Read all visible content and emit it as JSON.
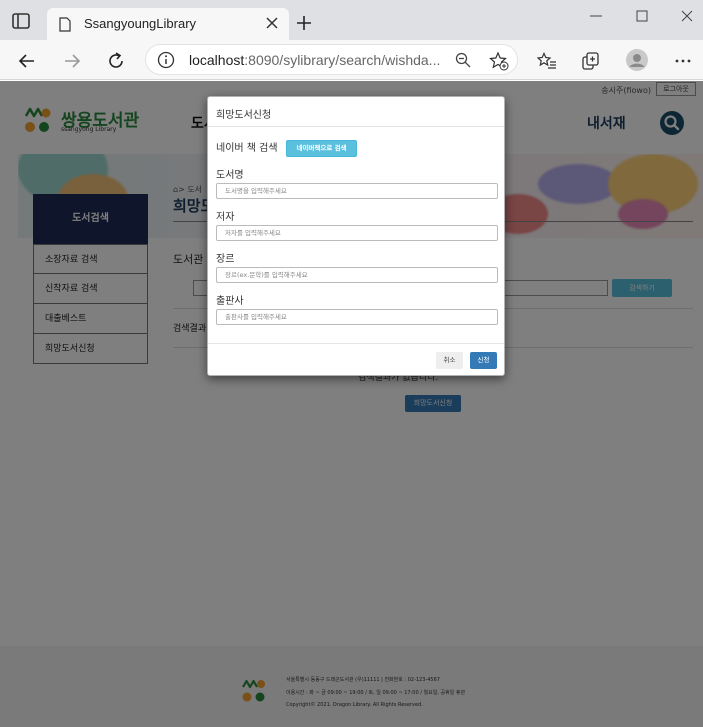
{
  "browser": {
    "tab_title": "SsangyoungLibrary",
    "url_host": "localhost",
    "url_path": ":8090/sylibrary/search/wishda..."
  },
  "header": {
    "user_text": "송시주(fiowo)",
    "logout_label": "로그아웃",
    "logo_title": "쌍용도서관",
    "logo_sub": "ssangyong Library",
    "gnb_left": "도서",
    "gnb_right": "내서재"
  },
  "sidebar": {
    "title": "도서검색",
    "items": [
      {
        "label": "소장자료 검색"
      },
      {
        "label": "신착자료 검색"
      },
      {
        "label": "대출베스트"
      },
      {
        "label": "희망도서신청"
      }
    ]
  },
  "main": {
    "breadcrumb": "> 도서",
    "page_title": "희망도",
    "section_label": "도서관",
    "search_placeholder": "",
    "search_btn": "검색하기",
    "result_label": "검색결과",
    "empty_msg": "검색결과가 없습니다.",
    "wish_btn": "희망도서신청"
  },
  "footer": {
    "lines": [
      "서울특별시 동동구 드래곤도서관 (우)11111 | 전화번호 : 02-123-4567",
      "이용시간 : 화 ~ 금 09:00 ~ 19:00 / 토, 일 09:00 ~ 17:00 / 월요일, 공휴일 휴관",
      "Copyright© 2021. Dragon Library. All Rights Reserved."
    ]
  },
  "modal": {
    "title": "희망도서신청",
    "naver_label": "네이버 책 검색",
    "naver_btn": "네이버책으로 검색",
    "fields": [
      {
        "label": "도서명",
        "placeholder": "도서명을 입력해주세요"
      },
      {
        "label": "저자",
        "placeholder": "저자를 입력해주세요"
      },
      {
        "label": "장르",
        "placeholder": "장르(ex.문학)를 입력해주세요"
      },
      {
        "label": "출판사",
        "placeholder": "출판사를 입력해주세요"
      }
    ],
    "cancel_label": "취소",
    "submit_label": "신청"
  },
  "colors": {
    "navy": "#1e2a55",
    "info": "#5bc0de",
    "primary": "#337ab7",
    "logo_green": "#2b8a3e"
  }
}
